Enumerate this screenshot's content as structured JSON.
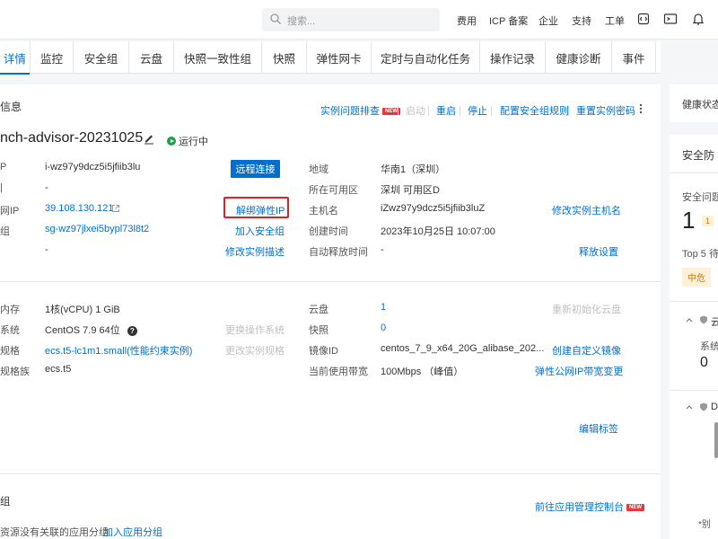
{
  "topbar": {
    "search_placeholder": "搜索...",
    "links": [
      "费用",
      "ICP 备案",
      "企业",
      "支持",
      "工单"
    ]
  },
  "tabs": [
    "详情",
    "监控",
    "安全组",
    "云盘",
    "快照一致性组",
    "快照",
    "弹性网卡",
    "定时与自动化任务",
    "操作记录",
    "健康诊断",
    "事件"
  ],
  "basic": {
    "section_title": "信息",
    "actions": {
      "troubleshoot": "实例问题排查",
      "new_badge": "NEW",
      "start": "启动",
      "restart": "重启",
      "stop": "停止",
      "config_sg": "配置安全组规则",
      "reset_pwd": "重置实例密码"
    },
    "instance_name": "nch-advisor-20231025",
    "status": "运行中",
    "instance_id": "i-wz97y9dcz5i5jfiib3lu",
    "dash1": "-",
    "public_ip_label": "网IP",
    "public_ip": "39.108.130.121",
    "label_row4": "组",
    "security_group": "sg-wz97jlxei5bypl73l8t2",
    "dash2": "-",
    "remote_connect": "远程连接",
    "unbind_eip": "解绑弹性IP",
    "join_sg": "加入安全组",
    "modify_desc": "修改实例描述",
    "region_label": "地域",
    "region": "华南1（深圳）",
    "zone_label": "所在可用区",
    "zone": "深圳 可用区D",
    "hostname_label": "主机名",
    "hostname": "iZwz97y9dcz5i5jfiib3luZ",
    "modify_hostname": "修改实例主机名",
    "created_label": "创建时间",
    "created": "2023年10月25日 10:07:00",
    "release_label": "自动释放时间",
    "release": "-",
    "release_setting": "释放设置"
  },
  "config": {
    "cpu_label": "内存",
    "cpu": "1核(vCPU) 1 GiB",
    "os_label": "系统",
    "os": "CentOS 7.9 64位",
    "change_os": "更换操作系统",
    "spec_label": "规格",
    "spec": "ecs.t5-lc1m1.small(性能约束实例)",
    "change_spec": "更改实例规格",
    "family_label": "规格族",
    "family": "ecs.t5",
    "disk_label": "云盘",
    "disk": "1",
    "reinit_disk": "重新初始化云盘",
    "snapshot_label": "快照",
    "snapshot": "0",
    "image_label": "镜像ID",
    "image": "centos_7_9_x64_20G_alibase_202...",
    "create_image": "创建自定义镜像",
    "bandwidth_label": "当前使用带宽",
    "bandwidth": "100Mbps （峰值）",
    "eip_bandwidth": "弹性公网IP带宽变更",
    "edit_tags": "编辑标签"
  },
  "appgroup": {
    "title": "组",
    "goto_console": "前往应用管理控制台",
    "new_badge": "NEW",
    "no_group_text": "资源没有关联的应用分组",
    "add_group": "加入应用分组"
  },
  "sidebar": {
    "health_title": "健康状态",
    "security_title": "安全防",
    "security_issue_label": "安全问题",
    "count_big": "1",
    "count_badge": "1",
    "top5": "Top 5 待",
    "severity": "中危",
    "cloud_label": "云",
    "system_label": "系统",
    "zero": "0",
    "d_label": "D",
    "footnote": "*别"
  },
  "colors": {
    "primary": "#0070cc",
    "running": "#1ba248",
    "highlight_box": "#e02020",
    "new_badge": "#e4393c",
    "severity_bg": "#fff0d9"
  }
}
